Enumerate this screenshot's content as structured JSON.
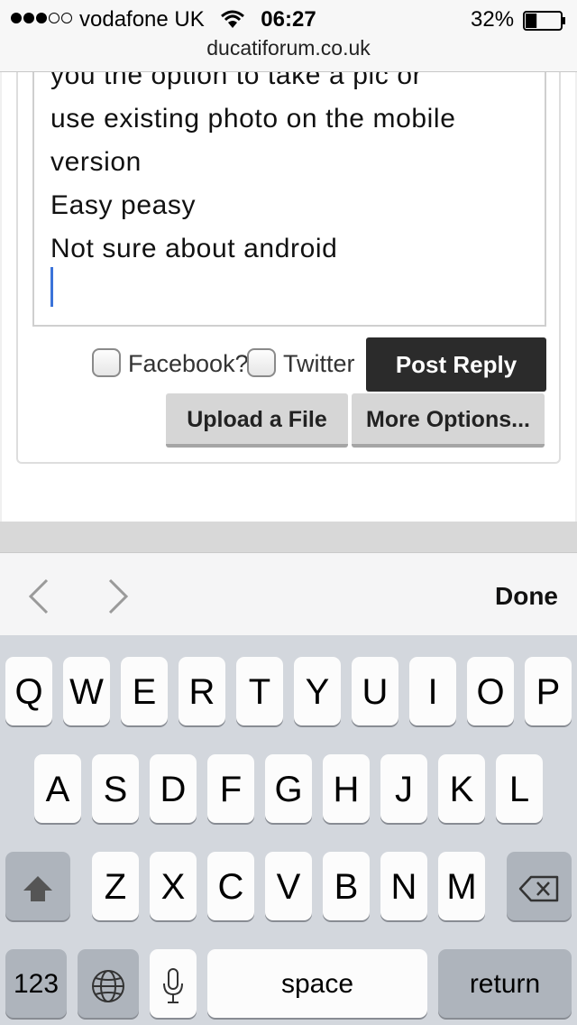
{
  "status_bar": {
    "signal_dots": [
      true,
      true,
      true,
      false,
      false
    ],
    "carrier": "vodafone UK",
    "wifi_icon": "wifi-icon",
    "time": "06:27",
    "battery_percent": "32%",
    "battery_level": 0.32,
    "url": "ducatiforum.co.uk"
  },
  "editor": {
    "lines": [
      "you the option to take a pic or",
      "use existing photo on the mobile",
      "version",
      "Easy peasy",
      "Not sure about android"
    ]
  },
  "reply_form": {
    "facebook_label": "Facebook?",
    "twitter_label": "Twitter",
    "post_reply": "Post Reply",
    "upload_file": "Upload a File",
    "more_options": "More Options..."
  },
  "accessory_bar": {
    "prev_icon": "chevron-left-icon",
    "next_icon": "chevron-right-icon",
    "done": "Done"
  },
  "keyboard": {
    "row1": [
      "Q",
      "W",
      "E",
      "R",
      "T",
      "Y",
      "U",
      "I",
      "O",
      "P"
    ],
    "row2": [
      "A",
      "S",
      "D",
      "F",
      "G",
      "H",
      "J",
      "K",
      "L"
    ],
    "row3": [
      "Z",
      "X",
      "C",
      "V",
      "B",
      "N",
      "M"
    ],
    "shift_icon": "shift-icon",
    "delete_icon": "delete-icon",
    "numbers": "123",
    "globe_icon": "globe-icon",
    "mic_icon": "microphone-icon",
    "space": "space",
    "return": "return"
  }
}
